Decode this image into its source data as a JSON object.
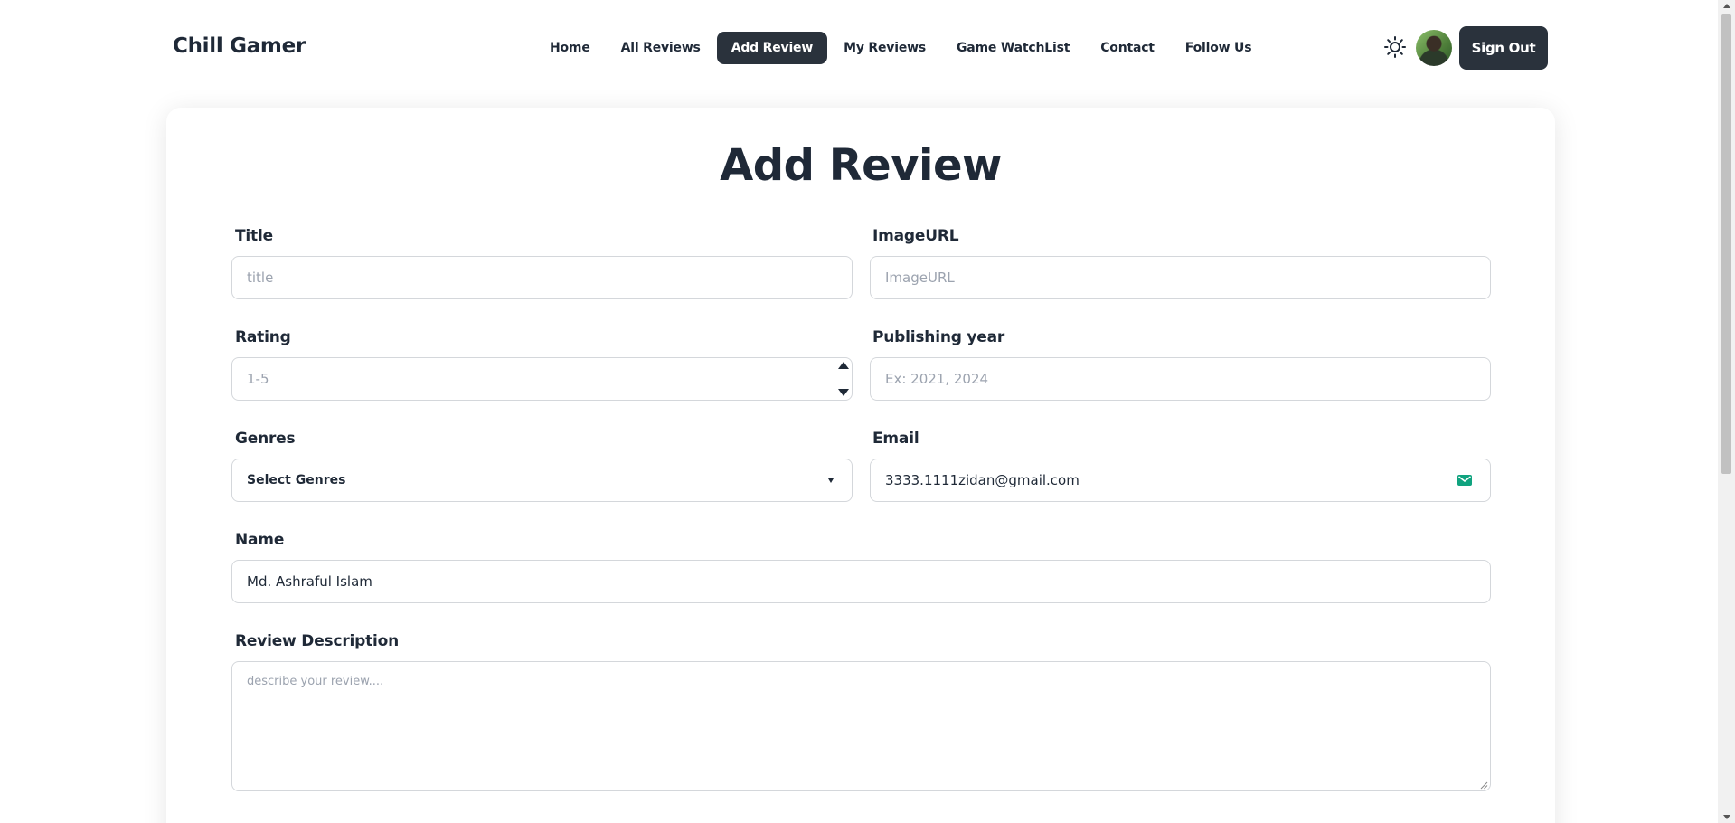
{
  "navbar": {
    "brand": "Chill Gamer",
    "links": [
      {
        "label": "Home",
        "active": false
      },
      {
        "label": "All Reviews",
        "active": false
      },
      {
        "label": "Add Review",
        "active": true
      },
      {
        "label": "My Reviews",
        "active": false
      },
      {
        "label": "Game WatchList",
        "active": false
      },
      {
        "label": "Contact",
        "active": false
      },
      {
        "label": "Follow Us",
        "active": false
      }
    ],
    "theme_icon": "sun-icon",
    "avatar_icon": "user-avatar",
    "signout_label": "Sign Out",
    "active_color": "#2a323c"
  },
  "form": {
    "title": "Add Review",
    "fields": {
      "title": {
        "label": "Title",
        "placeholder": "title",
        "value": ""
      },
      "image_url": {
        "label": "ImageURL",
        "placeholder": "ImageURL",
        "value": ""
      },
      "rating": {
        "label": "Rating",
        "placeholder": "1-5",
        "value": ""
      },
      "publishing_year": {
        "label": "Publishing year",
        "placeholder": "Ex: 2021, 2024",
        "value": ""
      },
      "genres": {
        "label": "Genres",
        "selected": "Select Genres"
      },
      "email": {
        "label": "Email",
        "value": "3333.1111zidan@gmail.com",
        "icon": "mail-icon",
        "icon_color": "#10a37f"
      },
      "name": {
        "label": "Name",
        "value": "Md. Ashraful Islam"
      },
      "description": {
        "label": "Review Description",
        "placeholder": "describe your review...."
      }
    }
  }
}
